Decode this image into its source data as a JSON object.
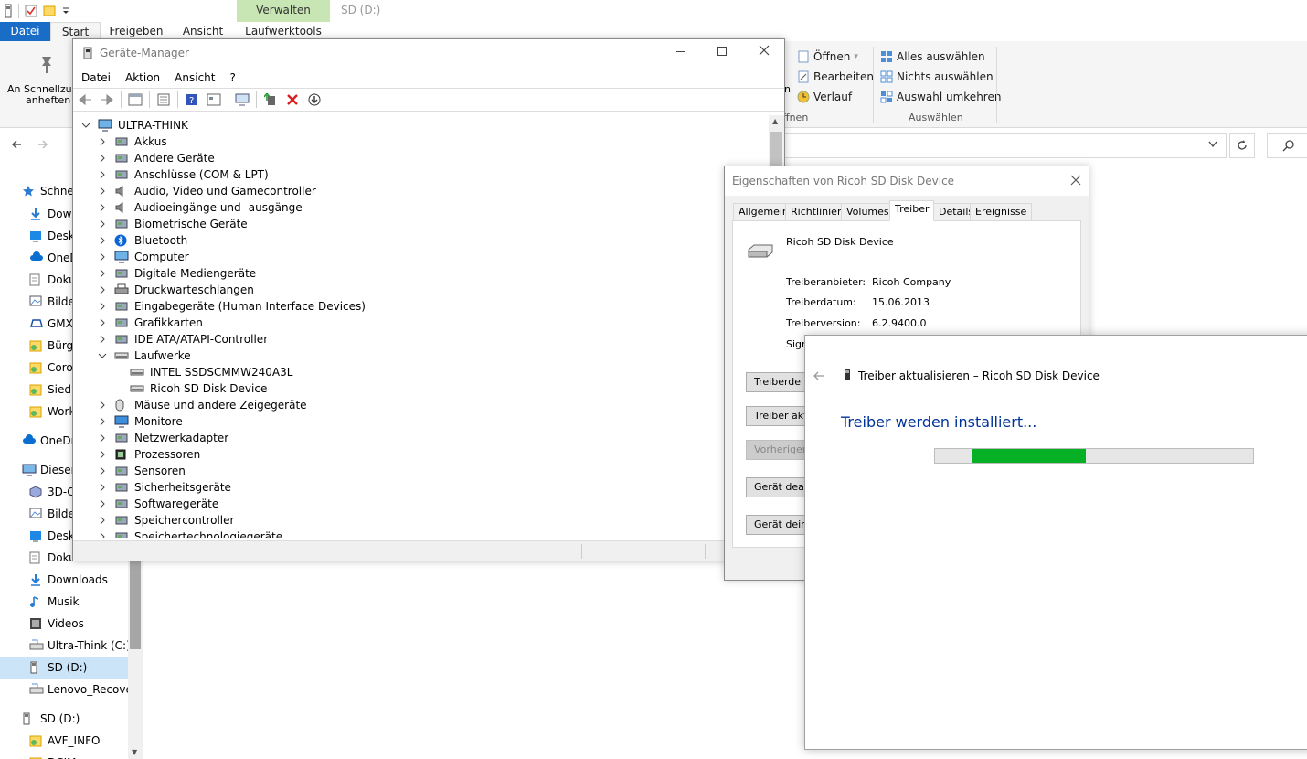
{
  "explorer": {
    "location_title": "SD (D:)",
    "ribbon_tabs": {
      "datei": "Datei",
      "start": "Start",
      "freigeben": "Freigeben",
      "ansicht": "Ansicht",
      "verwalten": "Verwalten",
      "laufwerktools": "Laufwerktools"
    },
    "ribbon": {
      "pin_line1": "An Schnellzug",
      "pin_line2": "anheften",
      "oeffnen": "Öffnen",
      "bearbeiten": "Bearbeiten",
      "verlauf": "Verlauf",
      "group_oeffnen": "ffnen",
      "alles_auswaehlen": "Alles auswählen",
      "nichts_auswaehlen": "Nichts auswählen",
      "auswahl_umkehren": "Auswahl umkehren",
      "group_auswaehlen": "Auswählen",
      "partial_n": "n"
    },
    "nav": [
      {
        "label": "Schnel",
        "icon": "star-icon"
      },
      {
        "label": "Dowr",
        "icon": "download-icon"
      },
      {
        "label": "Deskt",
        "icon": "desktop-icon"
      },
      {
        "label": "OneD",
        "icon": "cloud-icon"
      },
      {
        "label": "Doku",
        "icon": "document-icon"
      },
      {
        "label": "Bilde",
        "icon": "pictures-icon"
      },
      {
        "label": "GMX",
        "icon": "drive-cloud-icon"
      },
      {
        "label": "Bürg",
        "icon": "folder-icon"
      },
      {
        "label": "Coro",
        "icon": "folder-icon"
      },
      {
        "label": "Siedl",
        "icon": "folder-icon"
      },
      {
        "label": "Work",
        "icon": "folder-icon"
      },
      {
        "label": "OneDr",
        "icon": "cloud-icon"
      },
      {
        "label": "Dieser",
        "icon": "computer-icon"
      },
      {
        "label": "3D-C",
        "icon": "cube-icon"
      },
      {
        "label": "Bilde",
        "icon": "pictures-icon"
      },
      {
        "label": "Deskt",
        "icon": "desktop-icon"
      },
      {
        "label": "Doku",
        "icon": "document-icon"
      },
      {
        "label": "Downloads",
        "icon": "download-icon"
      },
      {
        "label": "Musik",
        "icon": "music-icon"
      },
      {
        "label": "Videos",
        "icon": "video-icon"
      },
      {
        "label": "Ultra-Think (C:)",
        "icon": "drive-icon"
      },
      {
        "label": "SD (D:)",
        "icon": "sd-drive-icon"
      },
      {
        "label": "Lenovo_Recover",
        "icon": "drive-icon"
      },
      {
        "label": "SD (D:)",
        "icon": "sd-drive-icon"
      },
      {
        "label": "AVF_INFO",
        "icon": "folder-icon"
      },
      {
        "label": "DCIM",
        "icon": "folder-icon"
      }
    ]
  },
  "devmgr": {
    "title": "Geräte-Manager",
    "menu": {
      "datei": "Datei",
      "aktion": "Aktion",
      "ansicht": "Ansicht",
      "help": "?"
    },
    "root": "ULTRA-THINK",
    "categories": [
      "Akkus",
      "Andere Geräte",
      "Anschlüsse (COM & LPT)",
      "Audio, Video und Gamecontroller",
      "Audioeingänge und -ausgänge",
      "Biometrische Geräte",
      "Bluetooth",
      "Computer",
      "Digitale Mediengeräte",
      "Druckwarteschlangen",
      "Eingabegeräte (Human Interface Devices)",
      "Grafikkarten",
      "IDE ATA/ATAPI-Controller",
      "Laufwerke",
      "INTEL SSDSCMMW240A3L",
      "Ricoh SD Disk Device",
      "Mäuse und andere Zeigegeräte",
      "Monitore",
      "Netzwerkadapter",
      "Prozessoren",
      "Sensoren",
      "Sicherheitsgeräte",
      "Softwaregeräte",
      "Speichercontroller",
      "Speichertechnologiegeräte"
    ]
  },
  "props": {
    "title": "Eigenschaften von Ricoh SD Disk Device",
    "tabs": {
      "allgemein": "Allgemein",
      "richtlinien": "Richtlinien",
      "volumes": "Volumes",
      "treiber": "Treiber",
      "details": "Details",
      "ereignisse": "Ereignisse"
    },
    "device_name": "Ricoh SD Disk Device",
    "anbieter_label": "Treiberanbieter:",
    "anbieter_value": "Ricoh Company",
    "datum_label": "Treiberdatum:",
    "datum_value": "15.06.2013",
    "version_label": "Treiberversion:",
    "version_value": "6.2.9400.0",
    "signatur_label": "Sign",
    "buttons": {
      "details": "Treiberde",
      "update": "Treiber aktu",
      "rollback": "Vorheriger",
      "disable": "Gerät deakt",
      "uninstall": "Gerät deinst"
    }
  },
  "update_wizard": {
    "title": "Treiber aktualisieren – Ricoh SD Disk Device",
    "heading": "Treiber werden installiert...",
    "progress_start": 0.116,
    "progress_end": 0.476,
    "accent": "#003399",
    "progress_color": "#06b025"
  }
}
